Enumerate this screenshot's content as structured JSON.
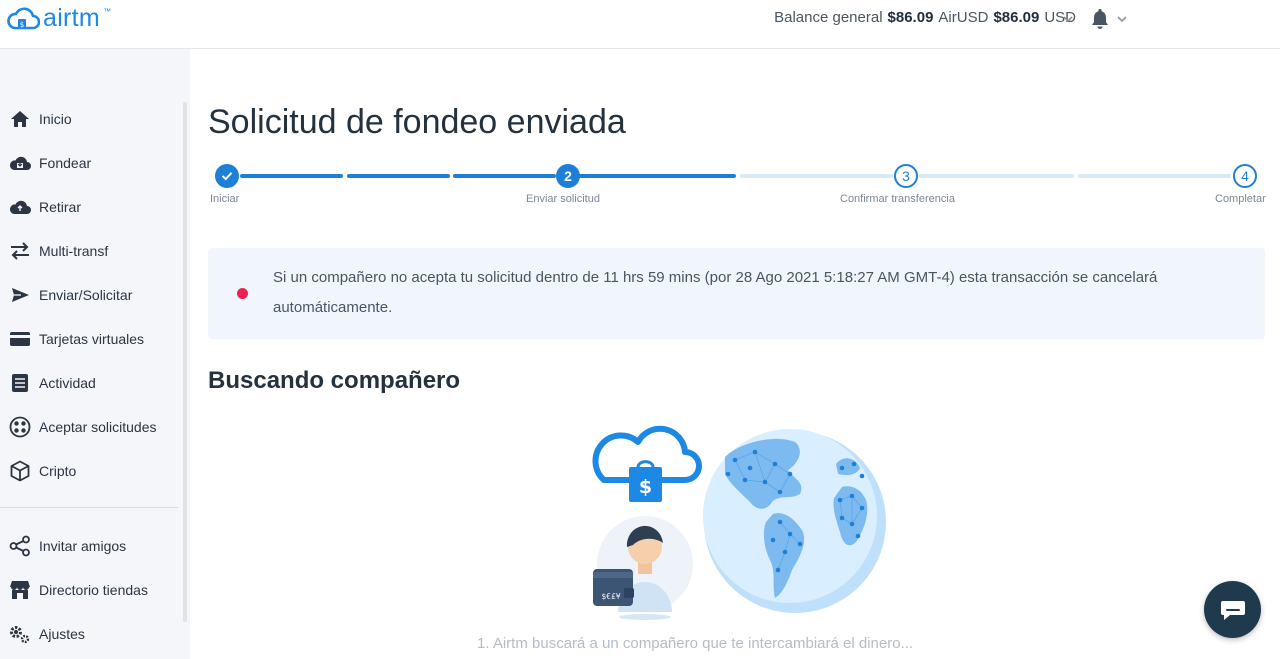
{
  "app": {
    "logo_text": "airtm",
    "logo_tm": "™"
  },
  "header": {
    "balance_label": "Balance general",
    "balance_airusd_amount": "$86.09",
    "balance_airusd_currency": "AirUSD",
    "balance_usd_amount": "$86.09",
    "balance_usd_currency": "USD"
  },
  "sidebar": {
    "items": [
      {
        "label": "Inicio",
        "icon": "home-icon"
      },
      {
        "label": "Fondear",
        "icon": "cloud-deposit-icon"
      },
      {
        "label": "Retirar",
        "icon": "cloud-withdraw-icon"
      },
      {
        "label": "Multi-transf",
        "icon": "transfer-arrows-icon"
      },
      {
        "label": "Enviar/Solicitar",
        "icon": "send-icon"
      },
      {
        "label": "Tarjetas virtuales",
        "icon": "credit-card-icon"
      },
      {
        "label": "Actividad",
        "icon": "activity-list-icon"
      },
      {
        "label": "Aceptar solicitudes",
        "icon": "accept-requests-icon"
      },
      {
        "label": "Cripto",
        "icon": "crypto-cube-icon"
      }
    ],
    "bottom_items": [
      {
        "label": "Invitar amigos",
        "icon": "share-icon"
      },
      {
        "label": "Directorio tiendas",
        "icon": "store-icon"
      },
      {
        "label": "Ajustes",
        "icon": "gear-icon"
      }
    ]
  },
  "main": {
    "title": "Solicitud de fondeo enviada",
    "steps": [
      {
        "number": "1",
        "label": "Iniciar",
        "state": "completed"
      },
      {
        "number": "2",
        "label": "Enviar solicitud",
        "state": "current"
      },
      {
        "number": "3",
        "label": "Confirmar transferencia",
        "state": "pending"
      },
      {
        "number": "4",
        "label": "Completar",
        "state": "pending"
      }
    ],
    "alert_text": "Si un compañero no acepta tu solicitud dentro de 11 hrs 59 mins (por 28 Ago 2021 5:18:27 AM GMT-4) esta transacción se cancelará automáticamente.",
    "section_title": "Buscando compañero",
    "wallet_text": "$€£¥",
    "caption": "1. Airtm buscará a un compañero que te intercambiará el dinero..."
  },
  "colors": {
    "brand_blue": "#1e88e5",
    "step_blue": "#1e7fd9",
    "alert_dot": "#e8254f",
    "chat_button": "#1f3a4d"
  }
}
